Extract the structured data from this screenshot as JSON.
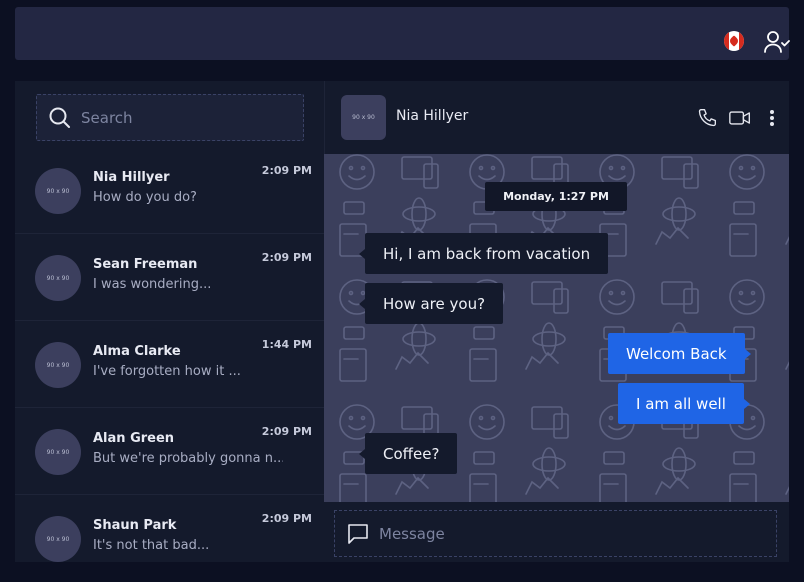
{
  "header": {
    "flag_icon": "canada-flag-icon",
    "user_icon": "user-check-icon"
  },
  "search": {
    "placeholder": "Search"
  },
  "contacts": [
    {
      "avatar": "90 x 90",
      "name": "Nia Hillyer",
      "preview": "How do you do?",
      "time": "2:09 PM"
    },
    {
      "avatar": "90 x 90",
      "name": "Sean Freeman",
      "preview": "I was wondering...",
      "time": "2:09 PM"
    },
    {
      "avatar": "90 x 90",
      "name": "Alma Clarke",
      "preview": "I've forgotten how it ...",
      "time": "1:44 PM"
    },
    {
      "avatar": "90 x 90",
      "name": "Alan Green",
      "preview": "But we're probably gonna n...",
      "time": "2:09 PM"
    },
    {
      "avatar": "90 x 90",
      "name": "Shaun Park",
      "preview": "It's not that bad...",
      "time": "2:09 PM"
    }
  ],
  "chat": {
    "avatar": "90 x 90",
    "title": "Nia Hillyer",
    "icons": [
      "phone-icon",
      "video-camera-icon",
      "more-vertical-icon"
    ],
    "date_label": "Monday, 1:27 PM",
    "messages": [
      {
        "direction": "in",
        "text": "Hi, I am back from vacation"
      },
      {
        "direction": "in",
        "text": "How are you?"
      },
      {
        "direction": "out",
        "text": "Welcom Back"
      },
      {
        "direction": "out",
        "text": "I am all well"
      },
      {
        "direction": "in",
        "text": "Coffee?"
      }
    ]
  },
  "composer": {
    "placeholder": "Message"
  },
  "colors": {
    "background": "#0c1022",
    "panel": "#141a2c",
    "topbar": "#232743",
    "chat_bg": "#3b3f5c",
    "outgoing_bubble": "#1f65e6"
  }
}
